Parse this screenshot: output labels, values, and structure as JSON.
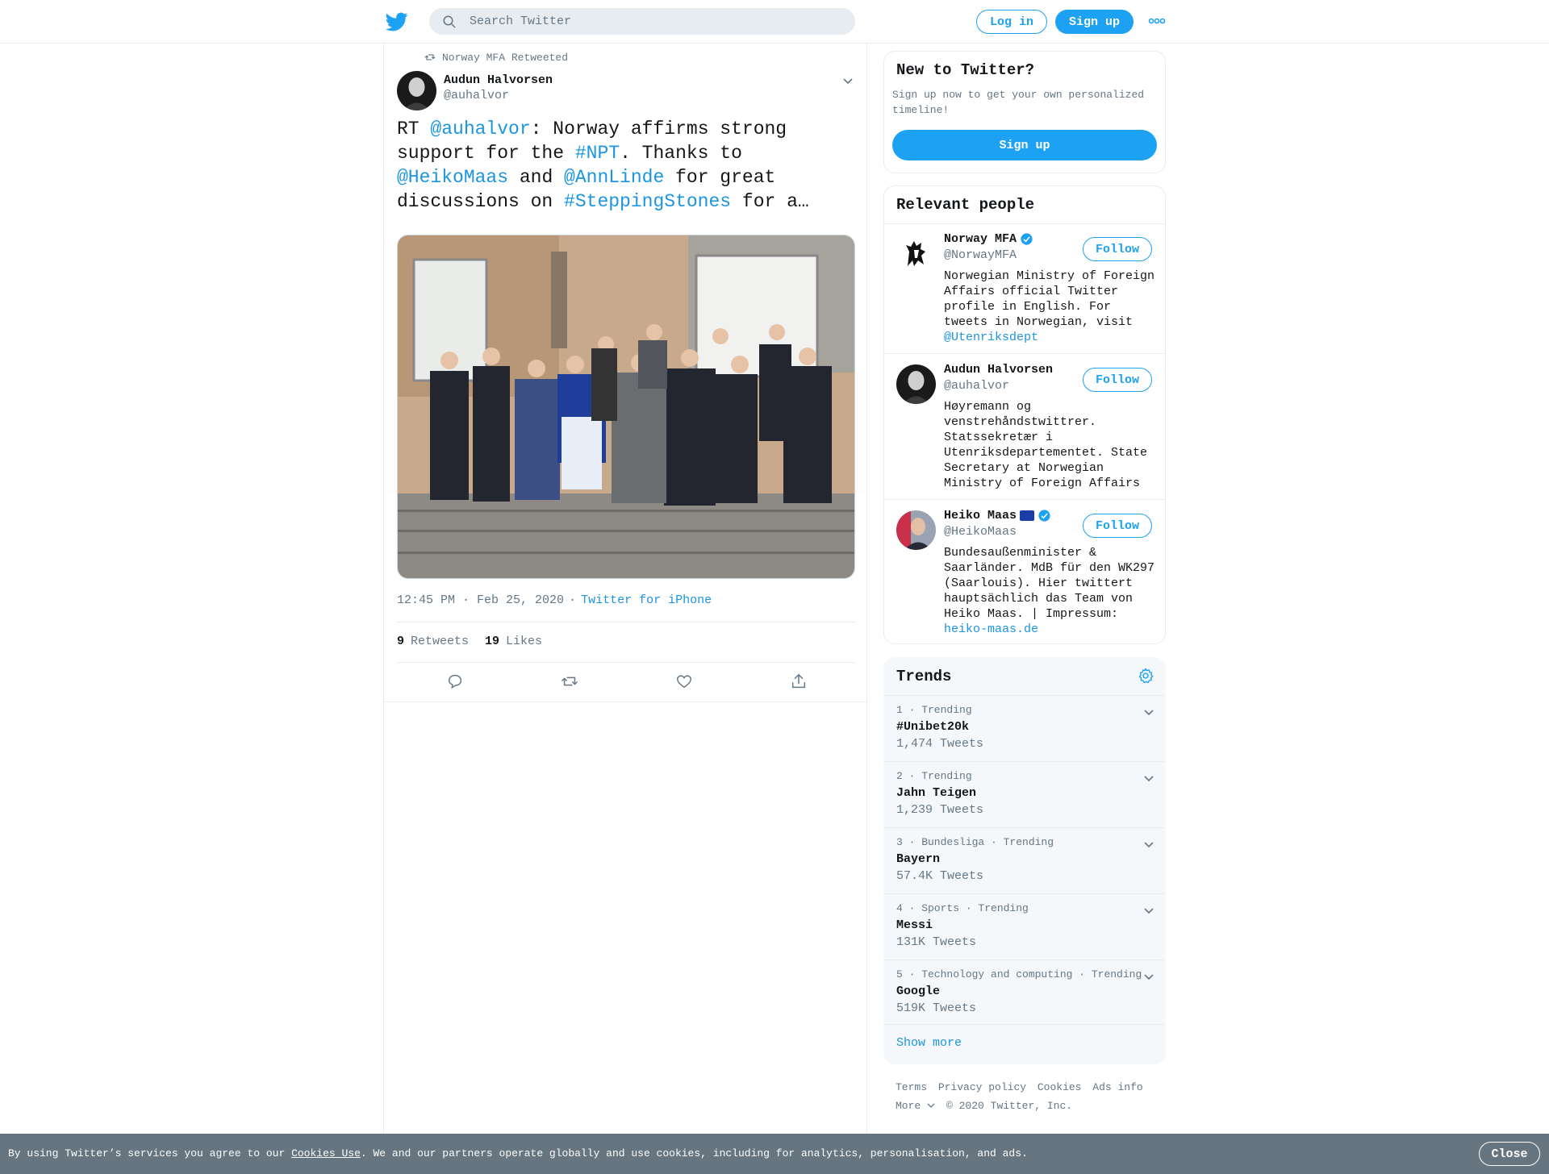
{
  "topbar": {
    "logo": "twitter-bird-icon",
    "search_placeholder": "Search Twitter",
    "login_label": "Log in",
    "signup_label": "Sign up",
    "more_icon": "more-dots-icon"
  },
  "tweet": {
    "retweeted_by": "Norway MFA Retweeted",
    "author_name": "Audun Halvorsen",
    "author_handle": "@auhalvor",
    "text_parts": [
      {
        "t": "RT ",
        "link": false
      },
      {
        "t": "@auhalvor",
        "link": true
      },
      {
        "t": ": Norway affirms strong support for the ",
        "link": false
      },
      {
        "t": "#NPT",
        "link": true
      },
      {
        "t": ". Thanks to ",
        "link": false
      },
      {
        "t": "@HeikoMaas",
        "link": true
      },
      {
        "t": " and ",
        "link": false
      },
      {
        "t": "@AnnLinde",
        "link": true
      },
      {
        "t": " for great discussions on ",
        "link": false
      },
      {
        "t": "#SteppingStones",
        "link": true
      },
      {
        "t": " for a…",
        "link": false
      }
    ],
    "time": "12:45 PM · Feb 25, 2020",
    "dot": "·",
    "source": "Twitter for iPhone",
    "retweets_count": "9",
    "retweets_label": "Retweets",
    "likes_count": "19",
    "likes_label": "Likes",
    "actions": [
      "reply-icon",
      "retweet-icon",
      "like-icon",
      "share-icon"
    ]
  },
  "sidebar": {
    "new_title": "New to Twitter?",
    "new_blurb": "Sign up now to get your own personalized timeline!",
    "new_signup": "Sign up",
    "people_title": "Relevant people",
    "people": [
      {
        "name": "Norway MFA",
        "handle": "@NorwayMFA",
        "follow": "Follow",
        "bio": "Norwegian Ministry of Foreign Affairs official Twitter profile in English. For tweets in Norwegian, visit ",
        "bio_link": "@Utenriksdept"
      },
      {
        "name": "Audun Halvorsen",
        "handle": "@auhalvor",
        "follow": "Follow",
        "bio": "Høyremann og venstrehåndstwittrer. Statssekretær i Utenriksdepartementet. State Secretary at Norwegian Ministry of Foreign Affairs",
        "bio_link": ""
      },
      {
        "name": "Heiko Maas",
        "handle": "@HeikoMaas",
        "follow": "Follow",
        "bio": "Bundesaußenminister & Saarländer. MdB für den WK297 (Saarlouis). Hier twittert hauptsächlich das Team von Heiko Maas. | Impressum: ",
        "bio_link": "heiko-maas.de"
      }
    ],
    "trends_title": "Trends",
    "trends": [
      {
        "meta": "1 · Trending",
        "name": "#Unibet20k",
        "count": "1,474 Tweets"
      },
      {
        "meta": "2 · Trending",
        "name": "Jahn Teigen",
        "count": "1,239 Tweets"
      },
      {
        "meta": "3 · Bundesliga · Trending",
        "name": "Bayern",
        "count": "57.4K Tweets"
      },
      {
        "meta": "4 · Sports · Trending",
        "name": "Messi",
        "count": "131K Tweets"
      },
      {
        "meta": "5 · Technology and computing · Trending",
        "name": "Google",
        "count": "519K Tweets"
      }
    ],
    "show_more": "Show more",
    "footer": {
      "terms": "Terms",
      "privacy": "Privacy policy",
      "cookies": "Cookies",
      "ads": "Ads info",
      "more": "More",
      "copyright": "© 2020 Twitter, Inc."
    }
  },
  "cookie_banner": {
    "text_before": "By using Twitter’s services you agree to our ",
    "link": "Cookies Use",
    "text_after": ". We and our partners operate globally and use cookies, including for analytics, personalisation, and ads.",
    "close": "Close"
  },
  "colors": {
    "accent": "#1da1f2",
    "link": "#1b95e0",
    "muted": "#657786",
    "banner": "#66757f"
  }
}
